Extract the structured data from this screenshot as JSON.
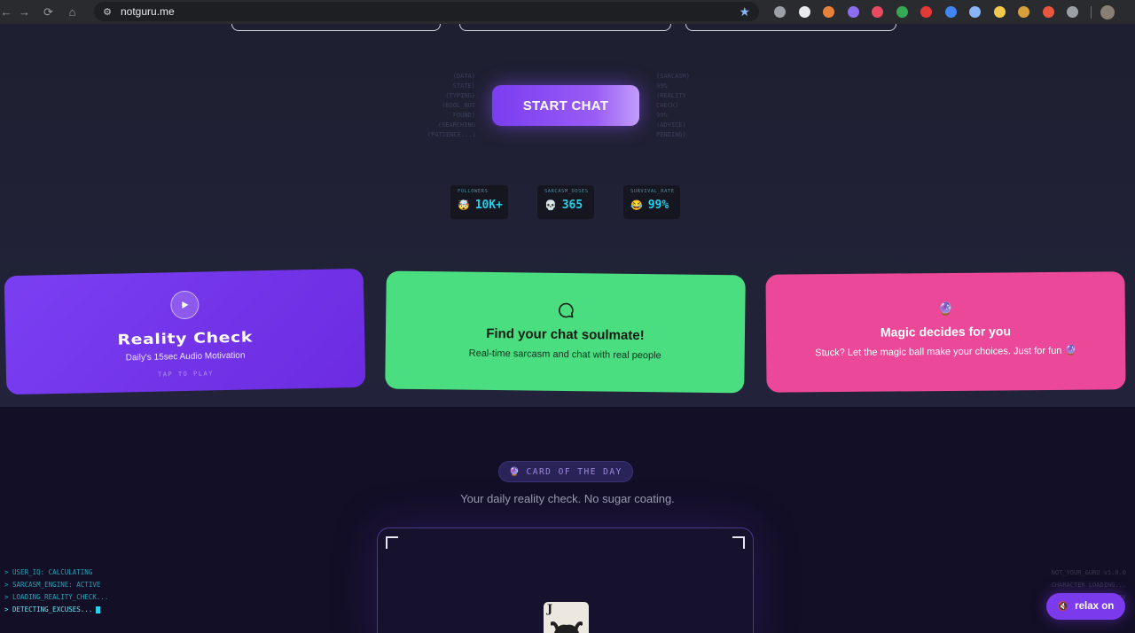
{
  "browser": {
    "url": "notguru.me",
    "back_glyph": "←",
    "forward_glyph": "→",
    "reload_glyph": "⟳",
    "home_glyph": "⌂",
    "site_info_glyph": "⚙",
    "star_glyph": "★",
    "extension_colors": [
      "#9aa0a6",
      "#e8eaed",
      "#e8823a",
      "#8e6cf0",
      "#e84a5f",
      "#34a853",
      "#e53935",
      "#4285f4",
      "#8ab4f8",
      "#f2c94c",
      "#d6a13b",
      "#e9573f",
      "#9aa0a6"
    ]
  },
  "hero": {
    "start_chat_label": "START CHAT",
    "left_code": [
      "(DATA)",
      "STATE)",
      "(TYPING)",
      "(BOOL_NOT",
      "FOUND)",
      "(SEARCHING",
      "(PATIENCE...)"
    ],
    "right_code": [
      "(SARCASM)",
      "99%",
      "(REALITY",
      "CHECK)",
      "99%",
      "(ADVICE)",
      "PENDING)"
    ]
  },
  "stats": [
    {
      "label": "FOLLOWERS",
      "emoji": "🤯",
      "value": "10K+"
    },
    {
      "label": "SARCASM_DOSES",
      "emoji": "💀",
      "value": "365"
    },
    {
      "label": "SURVIVAL_RATE",
      "emoji": "😂",
      "value": "99%"
    }
  ],
  "cards": {
    "reality": {
      "title": "Reality Check",
      "subtitle": "Daily's 15sec Audio Motivation",
      "tap_label": "TAP TO PLAY"
    },
    "chat": {
      "title": "Find your chat soulmate!",
      "subtitle": "Real-time sarcasm and chat with real people"
    },
    "magic": {
      "emoji": "🔮",
      "title": "Magic decides for you",
      "subtitle": "Stuck? Let the magic ball make your choices. Just for fun 🔮"
    }
  },
  "card_of_day": {
    "badge_emoji": "🔮",
    "badge_label": "CARD OF THE DAY",
    "subtitle": "Your daily reality check. No sugar coating.",
    "card_letter": "J"
  },
  "terminal": {
    "lines": [
      "> USER_IQ: CALCULATING",
      "> SARCASM_ENGINE: ACTIVE",
      "> LOADING_REALITY_CHECK...",
      "> DETECTING_EXCUSES..."
    ]
  },
  "bottom_right": {
    "lines": [
      "NOT_YOUR_GURU v1.0.0",
      "CHARACTER LOADING...",
      "MOTIV"
    ]
  },
  "relax": {
    "label": "relax on",
    "icon_glyph": "🔇"
  }
}
